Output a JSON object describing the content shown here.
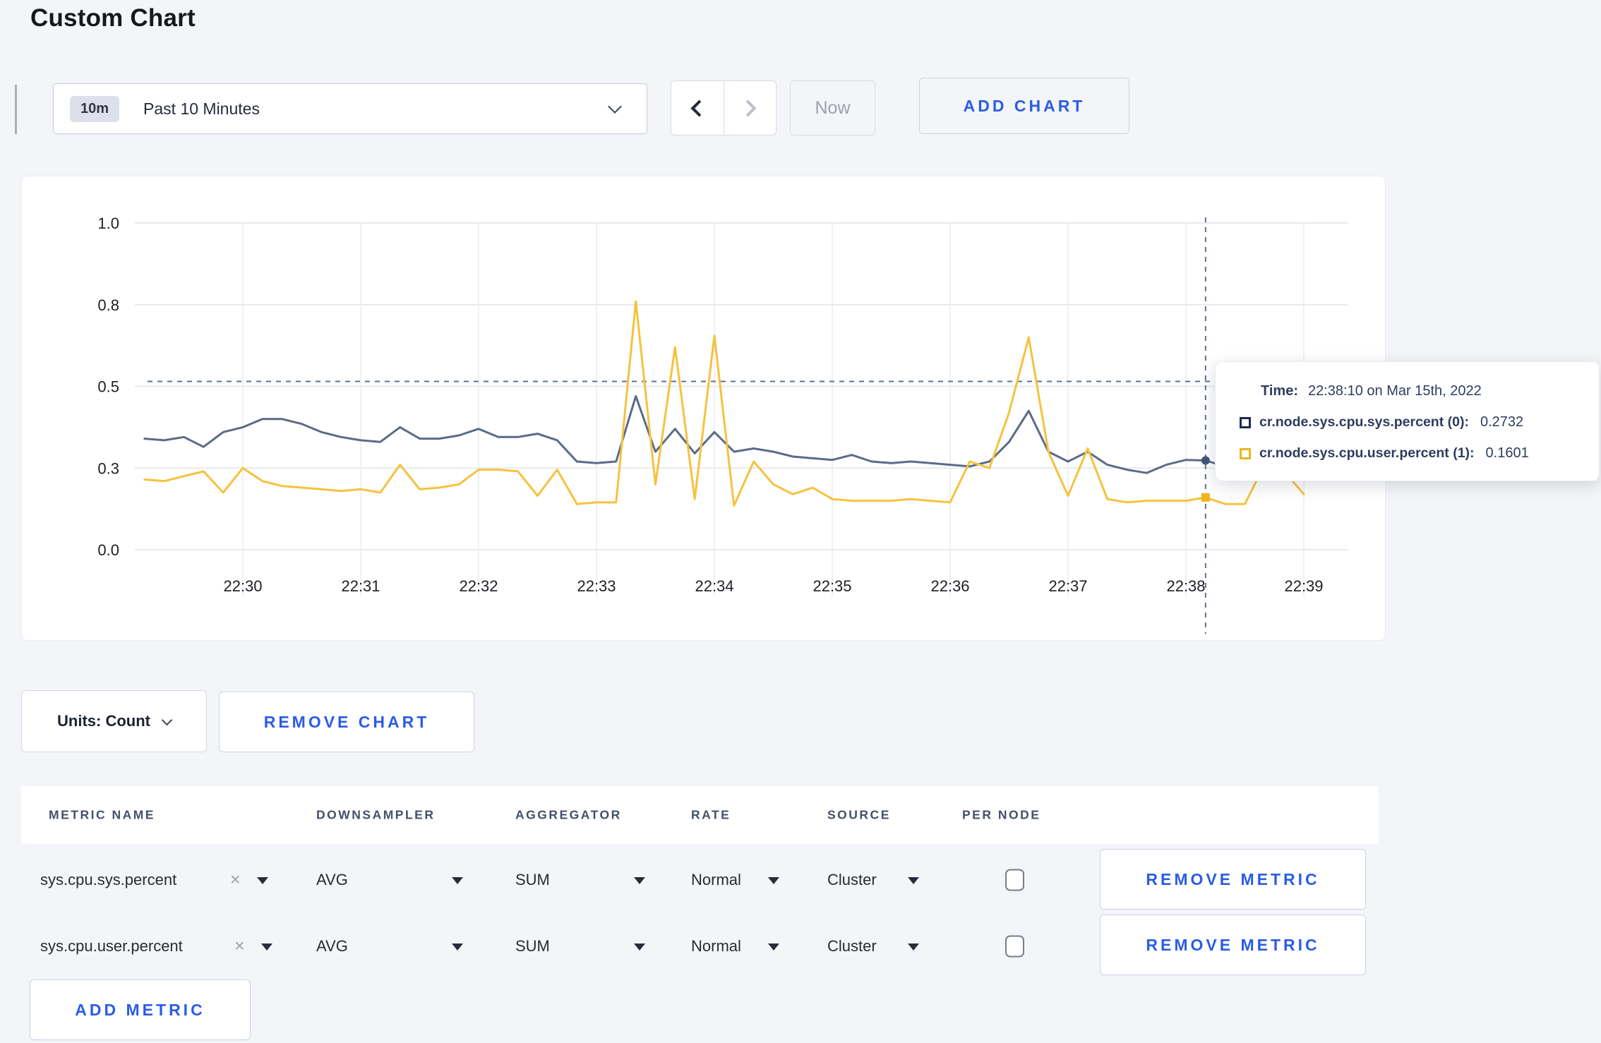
{
  "page": {
    "title": "Custom Chart"
  },
  "toolbar": {
    "time_badge": "10m",
    "time_label": "Past 10 Minutes",
    "now_label": "Now",
    "add_chart_label": "ADD CHART"
  },
  "tooltip": {
    "time_label": "Time:",
    "time_value": "22:38:10 on Mar 15th, 2022",
    "series": [
      {
        "name": "cr.node.sys.cpu.sys.percent (0):",
        "value": "0.2732",
        "color": "#1b2b4e"
      },
      {
        "name": "cr.node.sys.cpu.user.percent (1):",
        "value": "0.1601",
        "color": "#f0b41c"
      }
    ]
  },
  "chart_controls": {
    "units_label": "Units: Count",
    "remove_chart_label": "REMOVE CHART",
    "add_metric_label": "ADD METRIC"
  },
  "metrics_table": {
    "columns": [
      "METRIC NAME",
      "DOWNSAMPLER",
      "AGGREGATOR",
      "RATE",
      "SOURCE",
      "PER NODE"
    ],
    "remove_metric_label": "REMOVE METRIC",
    "rows": [
      {
        "metric": "sys.cpu.sys.percent",
        "downsampler": "AVG",
        "aggregator": "SUM",
        "rate": "Normal",
        "source": "Cluster",
        "per_node_checked": false
      },
      {
        "metric": "sys.cpu.user.percent",
        "downsampler": "AVG",
        "aggregator": "SUM",
        "rate": "Normal",
        "source": "Cluster",
        "per_node_checked": false
      }
    ]
  },
  "chart_data": {
    "type": "line",
    "title": "",
    "x_axis_label": "",
    "y_axis_label": "",
    "ylim": [
      0,
      1
    ],
    "grid": true,
    "x_ticks": [
      "22:30",
      "22:31",
      "22:32",
      "22:33",
      "22:34",
      "22:35",
      "22:36",
      "22:37",
      "22:38",
      "22:39"
    ],
    "y_tick_values": [
      0,
      0.25,
      0.5,
      0.75,
      1.0
    ],
    "y_tick_labels": [
      "0.0",
      "0.3",
      "0.5",
      "0.8",
      "1.0"
    ],
    "x_start_time": "22:29:10",
    "x_step_seconds": 10,
    "series": [
      {
        "name": "cr.node.sys.cpu.sys.percent",
        "color": "#5b6b87",
        "values": [
          0.34,
          0.335,
          0.345,
          0.315,
          0.36,
          0.375,
          0.4,
          0.4,
          0.385,
          0.36,
          0.345,
          0.335,
          0.33,
          0.375,
          0.34,
          0.34,
          0.35,
          0.37,
          0.345,
          0.345,
          0.355,
          0.335,
          0.27,
          0.265,
          0.27,
          0.47,
          0.3,
          0.37,
          0.295,
          0.36,
          0.3,
          0.31,
          0.3,
          0.285,
          0.28,
          0.275,
          0.29,
          0.27,
          0.265,
          0.27,
          0.265,
          0.26,
          0.255,
          0.27,
          0.33,
          0.425,
          0.3,
          0.27,
          0.3,
          0.26,
          0.245,
          0.235,
          0.26,
          0.275,
          0.2732,
          0.255,
          0.26,
          0.27,
          0.265,
          0.27
        ]
      },
      {
        "name": "cr.node.sys.cpu.user.percent",
        "color": "#f6c23e",
        "values": [
          0.215,
          0.21,
          0.225,
          0.24,
          0.175,
          0.25,
          0.21,
          0.195,
          0.19,
          0.185,
          0.18,
          0.185,
          0.175,
          0.26,
          0.185,
          0.19,
          0.2,
          0.245,
          0.245,
          0.24,
          0.165,
          0.245,
          0.14,
          0.145,
          0.145,
          0.76,
          0.2,
          0.62,
          0.155,
          0.655,
          0.135,
          0.27,
          0.2,
          0.17,
          0.19,
          0.155,
          0.15,
          0.15,
          0.15,
          0.155,
          0.15,
          0.145,
          0.27,
          0.25,
          0.42,
          0.65,
          0.3,
          0.165,
          0.31,
          0.155,
          0.145,
          0.15,
          0.15,
          0.15,
          0.1601,
          0.14,
          0.14,
          0.26,
          0.24,
          0.17
        ]
      }
    ],
    "crosshair": {
      "x_time": "22:38:10",
      "hline_value": 0.515,
      "points": [
        {
          "series": 0,
          "value": 0.2732,
          "shape": "circle",
          "color": "#44557a"
        },
        {
          "series": 1,
          "value": 0.1601,
          "shape": "square",
          "color": "#f0b41c"
        }
      ]
    },
    "legend_position": "tooltip"
  }
}
